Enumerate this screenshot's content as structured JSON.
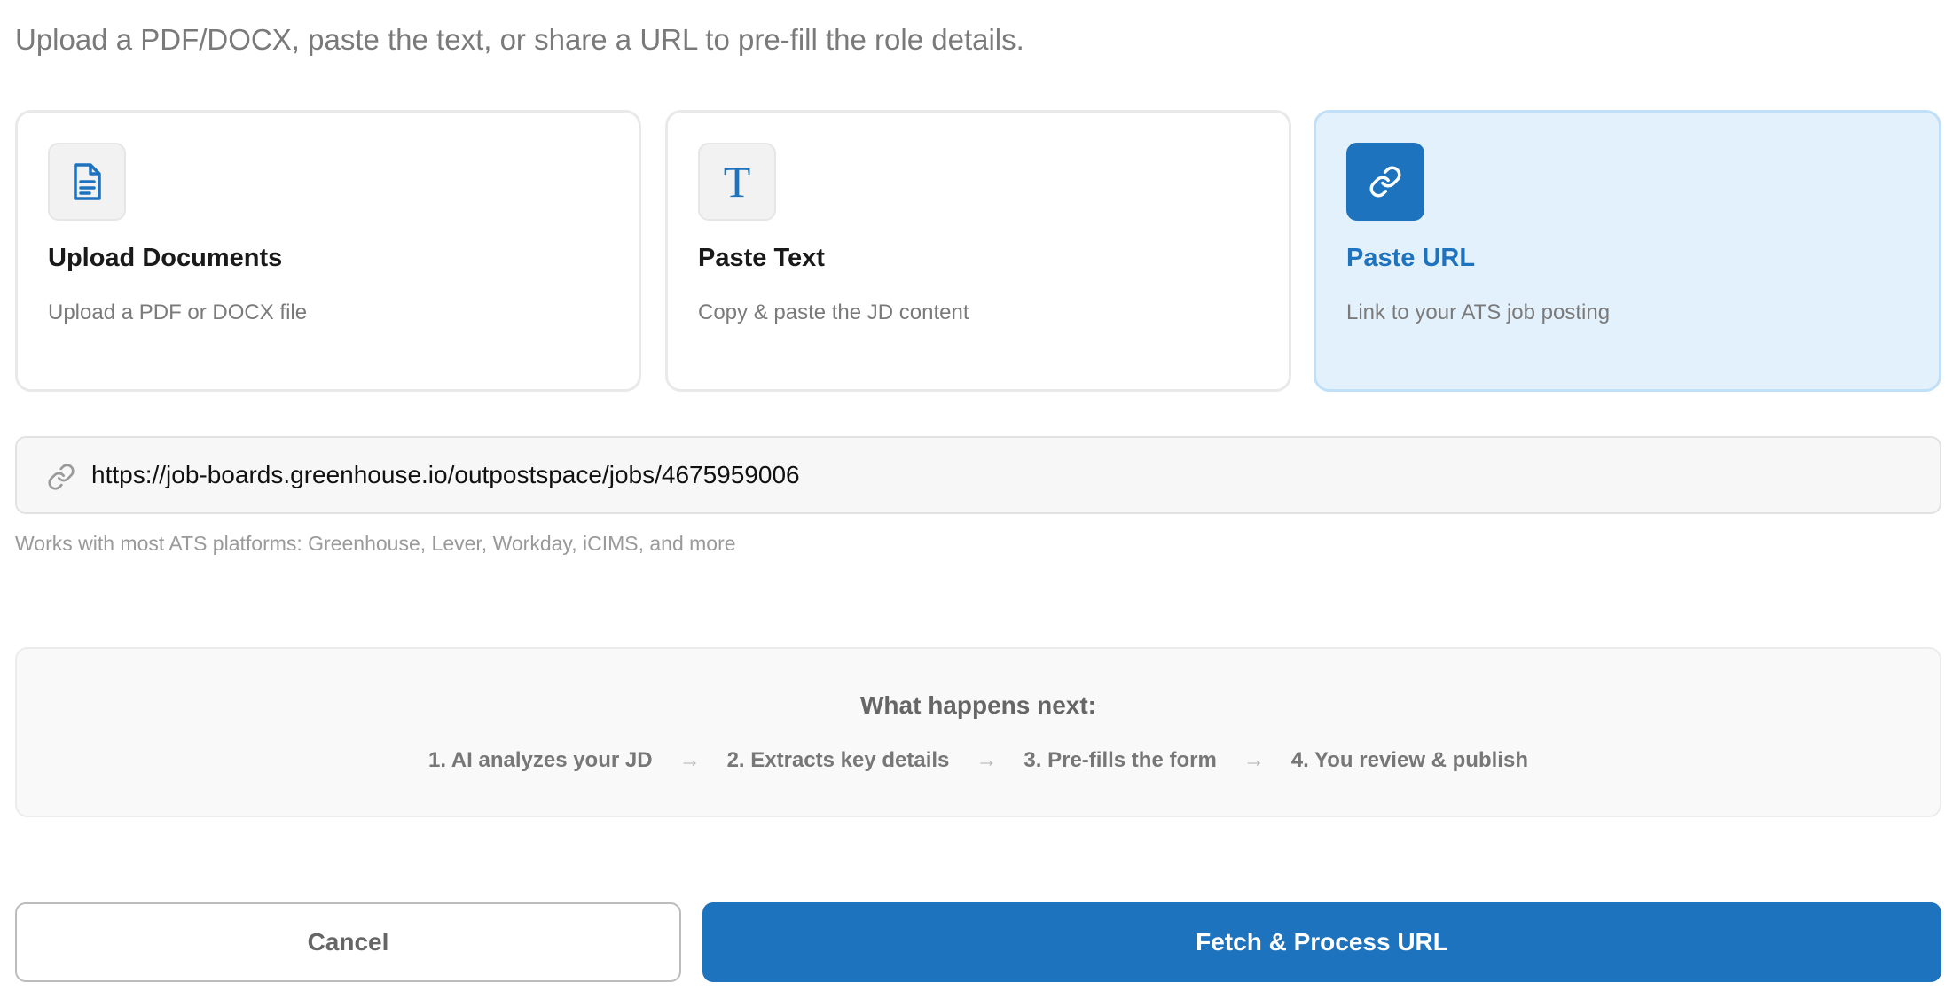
{
  "intro": "Upload a PDF/DOCX, paste the text, or share a URL to pre-fill the role details.",
  "options": [
    {
      "title": "Upload Documents",
      "description": "Upload a PDF or DOCX file",
      "icon": "document-icon",
      "selected": false
    },
    {
      "title": "Paste Text",
      "description": "Copy & paste the JD content",
      "icon": "text-icon",
      "selected": false
    },
    {
      "title": "Paste URL",
      "description": "Link to your ATS job posting",
      "icon": "link-icon",
      "selected": true
    }
  ],
  "url_input": {
    "value": "https://job-boards.greenhouse.io/outpostspace/jobs/4675959006",
    "icon": "link-icon"
  },
  "hint": "Works with most ATS platforms: Greenhouse, Lever, Workday, iCIMS, and more",
  "next": {
    "title": "What happens next:",
    "steps": [
      "1. AI analyzes your JD",
      "2. Extracts key details",
      "3. Pre-fills the form",
      "4. You review & publish"
    ],
    "separator": "→"
  },
  "actions": {
    "cancel_label": "Cancel",
    "submit_label": "Fetch & Process URL"
  },
  "colors": {
    "accent": "#1e73be",
    "selected_bg": "#e3f1fc",
    "selected_border": "#bfe0f8"
  }
}
